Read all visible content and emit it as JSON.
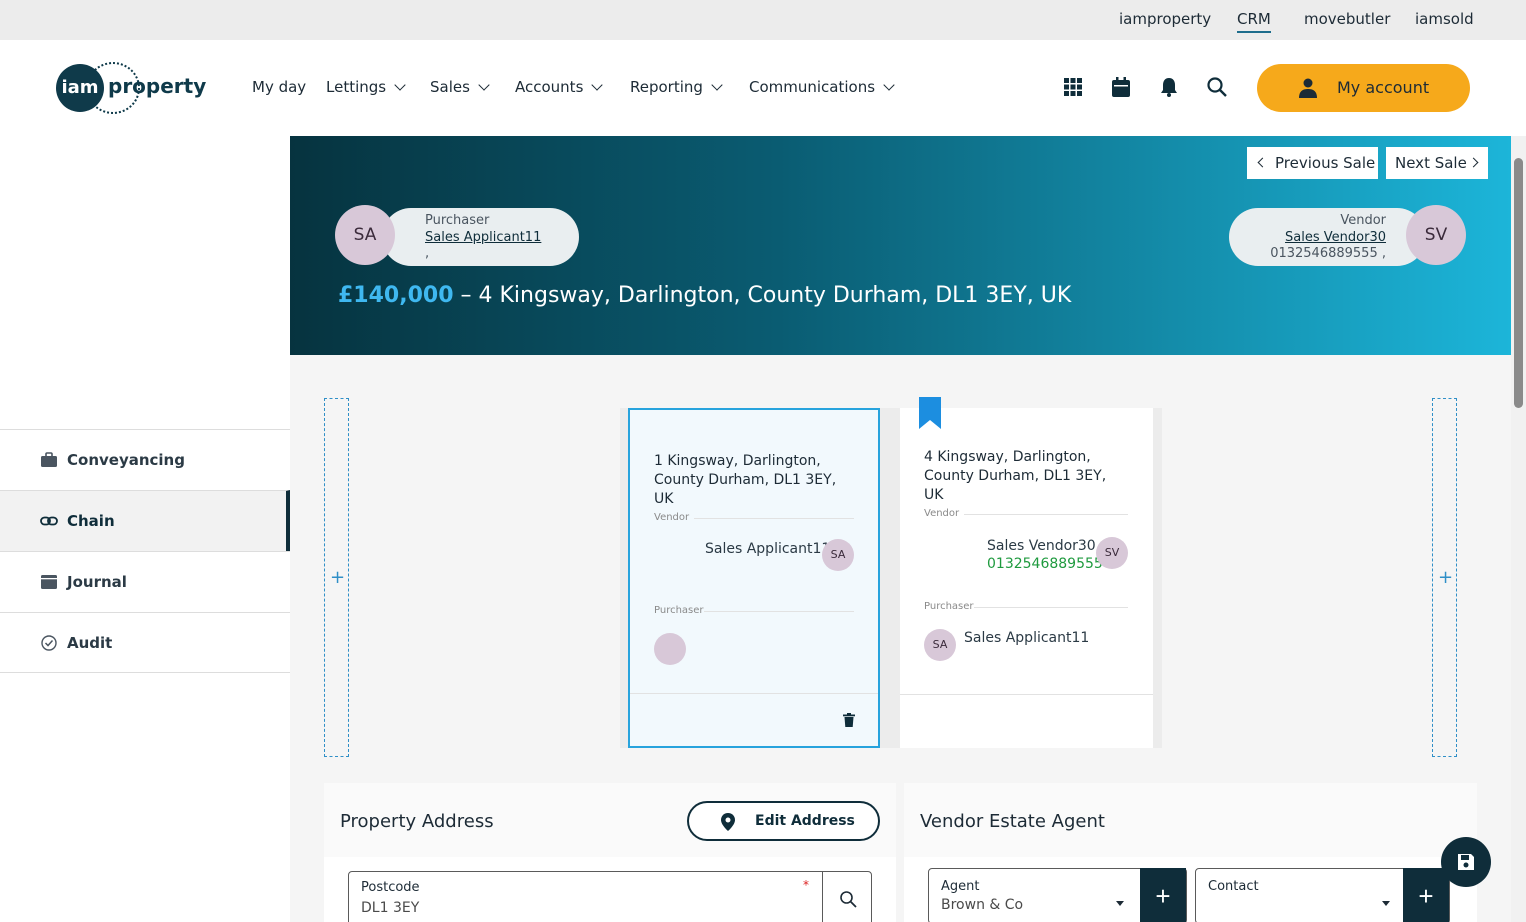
{
  "topbar": {
    "links": [
      "iamproperty",
      "CRM",
      "movebutler",
      "iamsold"
    ],
    "active": "CRM"
  },
  "header": {
    "logo": {
      "mark": "iam",
      "word": "property"
    },
    "nav": [
      "My day",
      "Lettings",
      "Sales",
      "Accounts",
      "Reporting",
      "Communications"
    ],
    "icons": [
      "apps-grid-icon",
      "calendar-icon",
      "bell-icon",
      "search-icon"
    ],
    "account_label": "My account",
    "account_color": "#f6a91b"
  },
  "sidebar": {
    "items": [
      {
        "label": "Conveyancing",
        "icon": "briefcase-icon"
      },
      {
        "label": "Chain",
        "icon": "link-icon"
      },
      {
        "label": "Journal",
        "icon": "journal-icon"
      },
      {
        "label": "Audit",
        "icon": "check-circle-icon"
      }
    ],
    "active": "Chain"
  },
  "banner": {
    "previous_label": "Previous Sale",
    "next_label": "Next Sale",
    "purchaser": {
      "initials": "SA",
      "role": "Purchaser",
      "name": "Sales Applicant11",
      "extra": ","
    },
    "vendor": {
      "initials": "SV",
      "role": "Vendor",
      "name": "Sales Vendor30",
      "phone": "0132546889555 ,"
    },
    "price": "£140,000",
    "address_line": "– 4 Kingsway, Darlington, County Durham, DL1 3EY, UK"
  },
  "chain": {
    "add_symbol": "+",
    "cards": [
      {
        "address": "1 Kingsway, Darlington, County Durham, DL1 3EY, UK",
        "vendor_label": "Vendor",
        "vendor_name": "Sales Applicant11",
        "vendor_initials": "SA",
        "purchaser_label": "Purchaser",
        "purchaser_name": "",
        "purchaser_initials": ""
      },
      {
        "address": "4 Kingsway, Darlington, County Durham, DL1 3EY, UK",
        "vendor_label": "Vendor",
        "vendor_name": "Sales Vendor30",
        "vendor_phone": "0132546889555",
        "vendor_initials": "SV",
        "purchaser_label": "Purchaser",
        "purchaser_name": "Sales Applicant11",
        "purchaser_initials": "SA"
      }
    ]
  },
  "property_address": {
    "title": "Property Address",
    "edit_label": "Edit Address",
    "postcode_label": "Postcode",
    "postcode_value": "DL1 3EY",
    "required_mark": "*"
  },
  "vendor_agent": {
    "title": "Vendor Estate Agent",
    "agent_label": "Agent",
    "agent_value": "Brown & Co",
    "contact_label": "Contact",
    "contact_value": "",
    "add_symbol": "+"
  }
}
